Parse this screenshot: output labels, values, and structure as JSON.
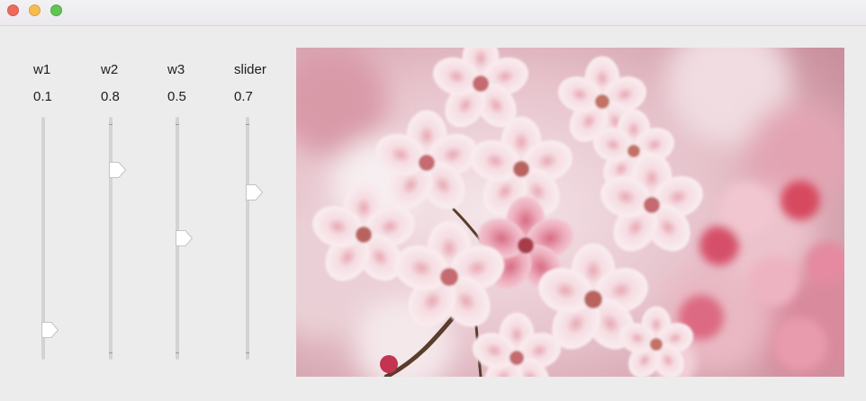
{
  "window": {
    "title": ""
  },
  "sliders": [
    {
      "name": "w1",
      "value_text": "0.1",
      "value": 0.1
    },
    {
      "name": "w2",
      "value_text": "0.8",
      "value": 0.8
    },
    {
      "name": "w3",
      "value_text": "0.5",
      "value": 0.5
    },
    {
      "name": "slider",
      "value_text": "0.7",
      "value": 0.7
    }
  ],
  "image": {
    "subject": "pink cherry blossoms"
  },
  "colors": {
    "close": "#ee6a5f",
    "minimize": "#f5bd4f",
    "maximize": "#61c454",
    "window_bg": "#ececec",
    "track": "#d3d3d3"
  }
}
